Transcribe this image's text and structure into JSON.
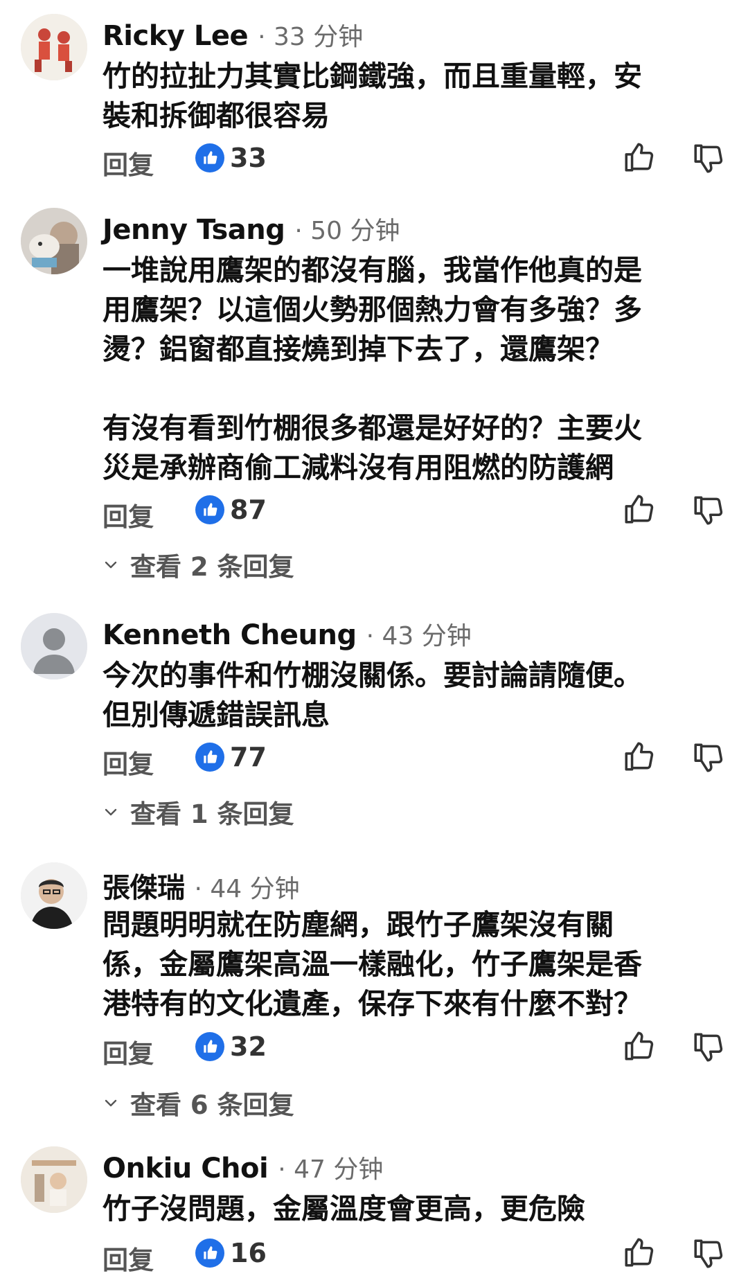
{
  "comments": [
    {
      "name": "Ricky Lee",
      "time": "· 33 分钟",
      "text": "竹的拉扯力其實比鋼鐵強，而且重量輕，安\n裝和拆御都很容易",
      "reply_label": "回复",
      "likes": "33"
    },
    {
      "name": "Jenny Tsang",
      "time": "· 50 分钟",
      "text": "一堆說用鷹架的都沒有腦，我當作他真的是\n用鷹架？以這個火勢那個熱力會有多強？多\n燙？鋁窗都直接燒到掉下去了，還鷹架？\n\n有沒有看到竹棚很多都還是好好的？主要火\n災是承辦商偷工減料沒有用阻燃的防護網",
      "reply_label": "回复",
      "likes": "87",
      "view_replies": "查看 2 条回复"
    },
    {
      "name": "Kenneth Cheung",
      "time": "· 43 分钟",
      "text": "今次的事件和竹棚沒關係。要討論請隨便。\n但別傳遞錯誤訊息",
      "reply_label": "回复",
      "likes": "77",
      "view_replies": "查看 1 条回复"
    },
    {
      "name": "張傑瑞",
      "time": "· 44 分钟",
      "text": "問題明明就在防塵網，跟竹子鷹架沒有關\n係，金屬鷹架高溫一樣融化，竹子鷹架是香\n港特有的文化遺產，保存下來有什麼不對？",
      "reply_label": "回复",
      "likes": "32",
      "view_replies": "查看 6 条回复"
    },
    {
      "name": "Onkiu Choi",
      "time": "· 47 分钟",
      "text": "竹子沒問題，金屬溫度會更高，更危險",
      "reply_label": "回复",
      "likes": "16"
    }
  ],
  "colors": {
    "like_blue": "#1f6fe8",
    "muted_text": "#6b6b6b"
  }
}
